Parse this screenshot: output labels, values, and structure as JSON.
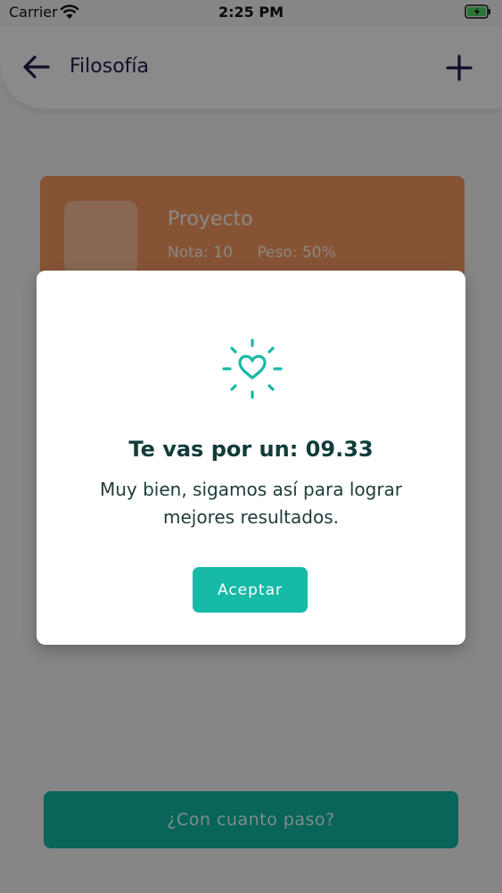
{
  "status_bar": {
    "carrier": "Carrier",
    "time": "2:25 PM"
  },
  "header": {
    "title": "Filosofía",
    "back_icon": "arrow-left-icon",
    "add_icon": "plus-icon"
  },
  "card": {
    "title": "Proyecto",
    "nota": "Nota: 10",
    "peso": "Peso: 50%",
    "color": "#f59a62"
  },
  "modal": {
    "icon": "heart-sparkle-icon",
    "heading": "Te vas por un: 09.33",
    "message": "Muy bien, sigamos así para lograr mejores resultados.",
    "accept_label": "Aceptar",
    "accent": "#17b9a7"
  },
  "bottom_button": {
    "label": "¿Con cuanto paso?"
  }
}
